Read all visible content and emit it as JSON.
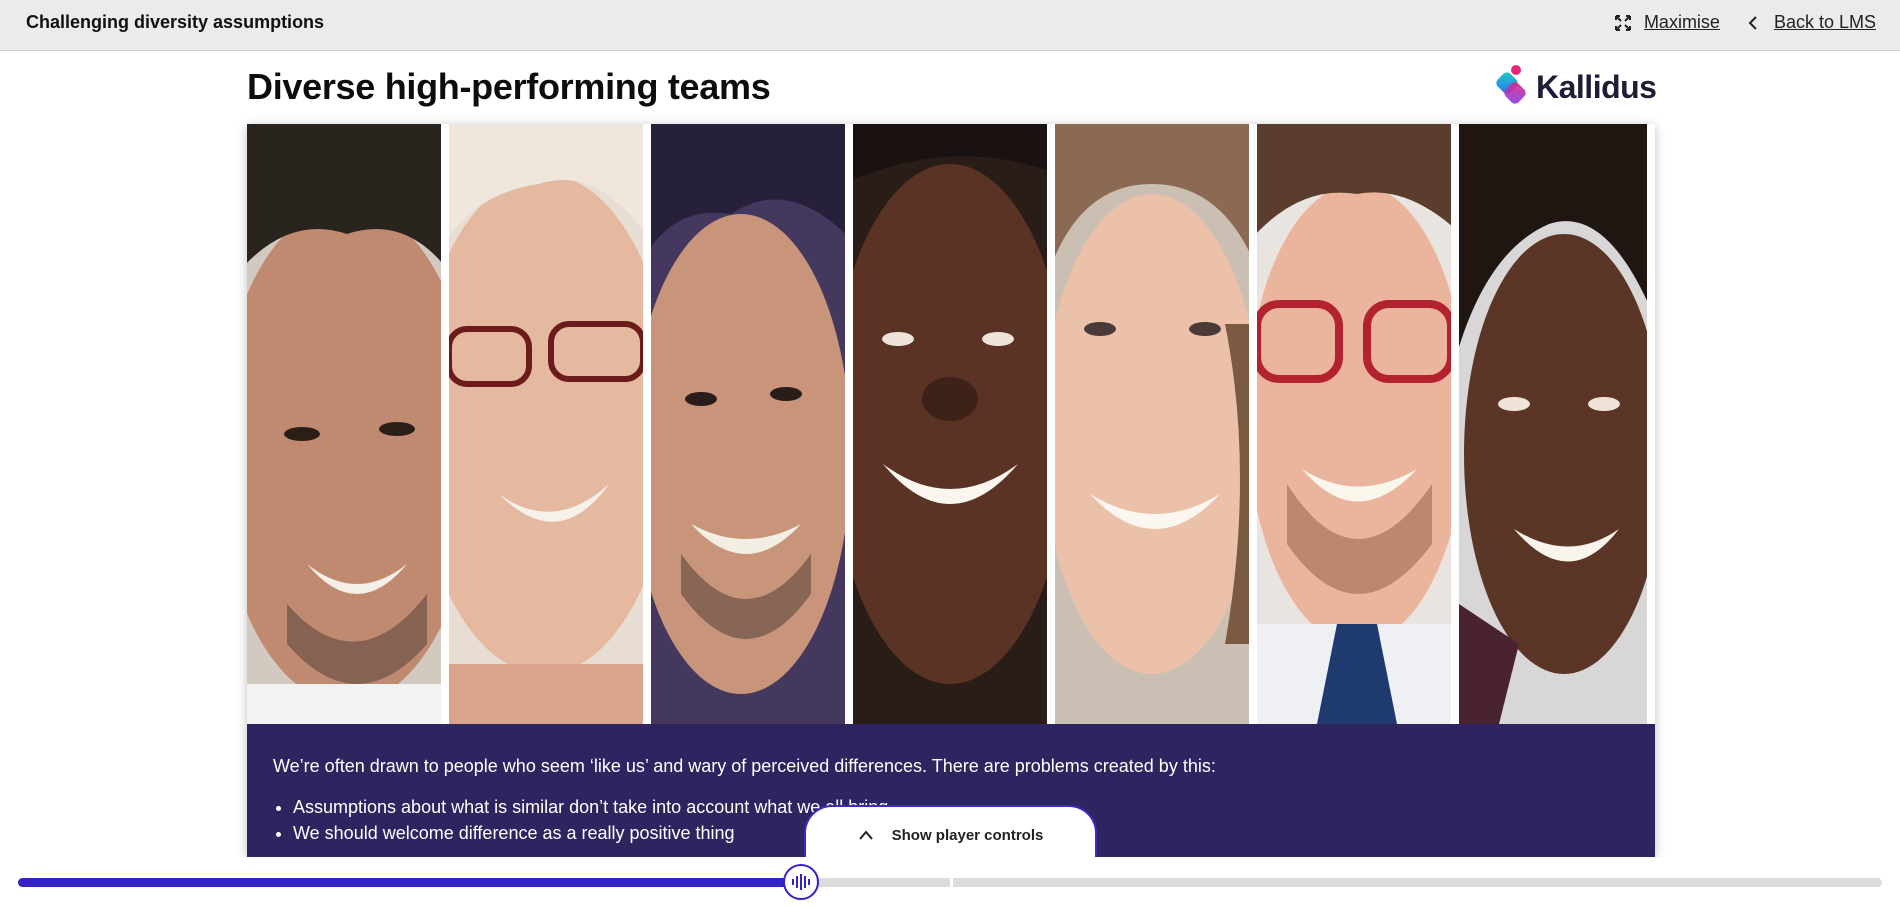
{
  "window": {
    "course_title": "Challenging diversity assumptions",
    "maximise_label": "Maximise",
    "back_label": "Back to LMS"
  },
  "slide": {
    "title": "Diverse high-performing teams",
    "logo_text": "Kallidus",
    "photos": [
      "man-with-dark-curly-hair-smiling",
      "woman-with-white-hair-and-glasses-smiling",
      "young-man-with-dark-hair-smiling",
      "man-with-shaved-head-smiling",
      "woman-with-brown-hair-smiling",
      "man-with-red-glasses-and-tie-smiling",
      "woman-with-curly-hair-smiling"
    ],
    "intro_text": "We’re often drawn to people who seem ‘like us’ and wary of perceived differences. There are problems created by this:",
    "bullets": [
      "Assumptions about what is similar don’t take into account what we all bring",
      "We should welcome difference as a really positive thing"
    ]
  },
  "player": {
    "show_controls_label": "Show player controls",
    "progress_percent": 42,
    "section_marker_percent": 50
  },
  "colors": {
    "accent": "#3323c4",
    "panel": "#2e2460",
    "topbar": "#ebebeb"
  },
  "icons": {
    "maximise": "maximise-icon",
    "back": "chevron-left-icon",
    "show_controls": "chevron-up-icon",
    "scrubber": "audio-bars-icon"
  }
}
